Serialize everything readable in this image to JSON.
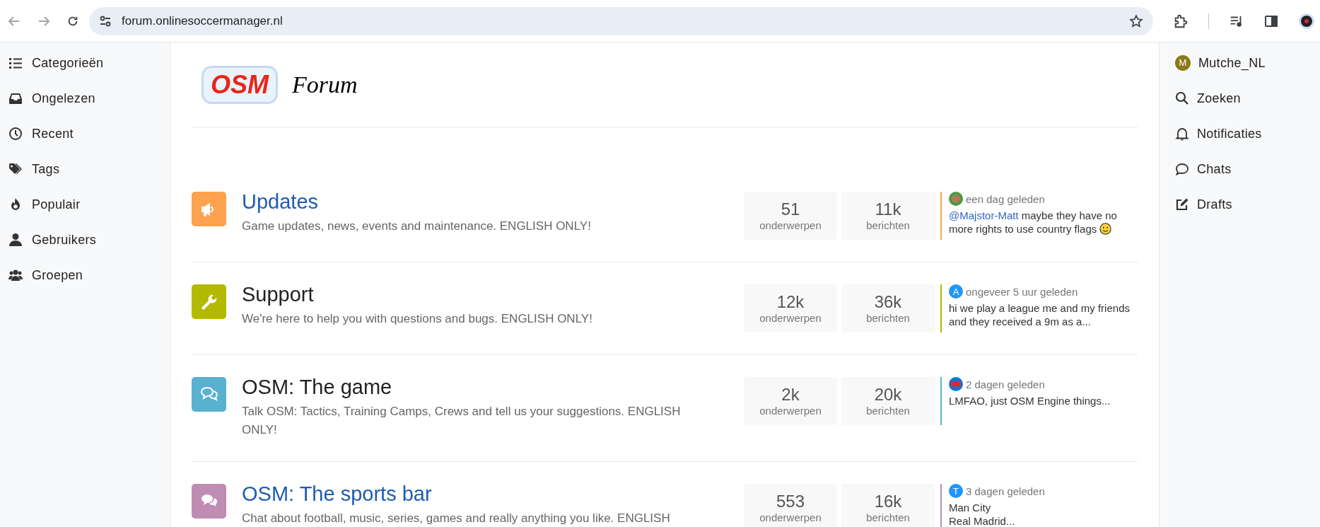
{
  "browser": {
    "url": "forum.onlinesoccermanager.nl"
  },
  "left_nav": [
    {
      "kind": "list",
      "label": "Categorieën"
    },
    {
      "kind": "inbox",
      "label": "Ongelezen"
    },
    {
      "kind": "clock",
      "label": "Recent"
    },
    {
      "kind": "tags",
      "label": "Tags"
    },
    {
      "kind": "fire",
      "label": "Populair"
    },
    {
      "kind": "user",
      "label": "Gebruikers"
    },
    {
      "kind": "users",
      "label": "Groepen"
    }
  ],
  "logo": {
    "mark": "OSM",
    "word": "Forum"
  },
  "categories": [
    {
      "kind": "megaphone",
      "color": "#fda24f",
      "title": "Updates",
      "unread": true,
      "description": "Game updates, news, events and maintenance. ENGLISH ONLY!",
      "topics": "51",
      "topics_label": "onderwerpen",
      "posts": "11k",
      "posts_label": "berichten",
      "last_post": {
        "avatar": {
          "kind": "photo"
        },
        "time": "een dag geleden",
        "mention": "@Majstor-Matt",
        "lines": [
          "maybe they have no more rights to use country flags"
        ],
        "smiley": true
      }
    },
    {
      "kind": "wrench",
      "color": "#b4b900",
      "title": "Support",
      "unread": false,
      "description": "We're here to help you with questions and bugs. ENGLISH ONLY!",
      "topics": "12k",
      "topics_label": "onderwerpen",
      "posts": "36k",
      "posts_label": "berichten",
      "last_post": {
        "avatar": {
          "kind": "letter",
          "letter": "A",
          "color": "#2196f3"
        },
        "time": "ongeveer 5 uur geleden",
        "lines": [
          "hi we play a league me and my friends and they received a 9m as a..."
        ],
        "smiley": false
      }
    },
    {
      "kind": "comments",
      "color": "#59b1d0",
      "title": "OSM: The game",
      "unread": false,
      "description": "Talk OSM: Tactics, Training Camps, Crews and tell us your suggestions. ENGLISH ONLY!",
      "topics": "2k",
      "topics_label": "onderwerpen",
      "posts": "20k",
      "posts_label": "berichten",
      "last_post": {
        "avatar": {
          "kind": "logo"
        },
        "time": "2 dagen geleden",
        "lines": [
          "LMFAO, just OSM Engine things..."
        ],
        "smiley": false
      }
    },
    {
      "kind": "comments-solid",
      "color": "#bf8cb4",
      "title": "OSM: The sports bar",
      "unread": true,
      "description": "Chat about football, music, series, games and really anything you like. ENGLISH",
      "topics": "553",
      "topics_label": "onderwerpen",
      "posts": "16k",
      "posts_label": "berichten",
      "last_post": {
        "avatar": {
          "kind": "letter",
          "letter": "T",
          "color": "#2196f3"
        },
        "time": "3 dagen geleden",
        "lines": [
          "Man City",
          "Real Madrid..."
        ],
        "smiley": false
      }
    }
  ],
  "right_nav": [
    {
      "kind": "avatar",
      "letter": "M",
      "color": "#8a7a19",
      "label": "Mutche_NL"
    },
    {
      "kind": "search",
      "label": "Zoeken"
    },
    {
      "kind": "bell",
      "label": "Notificaties"
    },
    {
      "kind": "chat",
      "label": "Chats"
    },
    {
      "kind": "edit",
      "label": "Drafts"
    }
  ]
}
